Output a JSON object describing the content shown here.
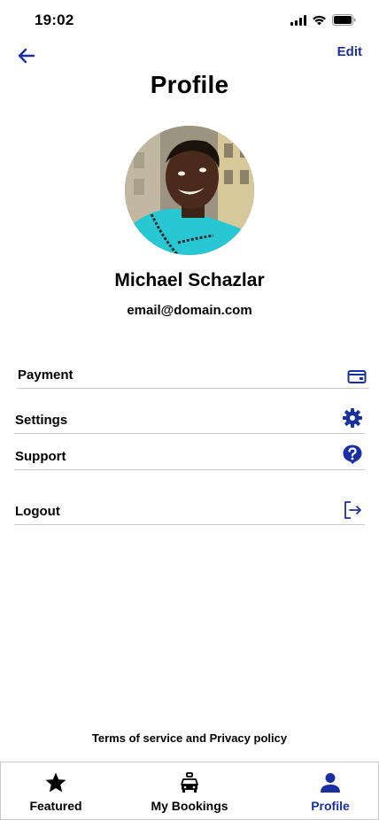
{
  "status_bar": {
    "time": "19:02"
  },
  "header": {
    "title": "Profile",
    "edit_label": "Edit"
  },
  "user": {
    "name": "Michael Schazlar",
    "email": "email@domain.com"
  },
  "menu": [
    {
      "label": "Payment",
      "icon": "credit-card-icon"
    },
    {
      "label": "Settings",
      "icon": "gear-icon"
    },
    {
      "label": "Support",
      "icon": "help-icon"
    },
    {
      "label": "Logout",
      "icon": "logout-icon"
    }
  ],
  "footer": {
    "terms": "Terms of service and Privacy policy"
  },
  "tabs": [
    {
      "label": "Featured",
      "icon": "star-icon",
      "active": false
    },
    {
      "label": "My Bookings",
      "icon": "car-icon",
      "active": false
    },
    {
      "label": "Profile",
      "icon": "person-icon",
      "active": true
    }
  ],
  "colors": {
    "accent": "#1a2fa0",
    "divider": "#c9c9c9",
    "text": "#000000"
  }
}
